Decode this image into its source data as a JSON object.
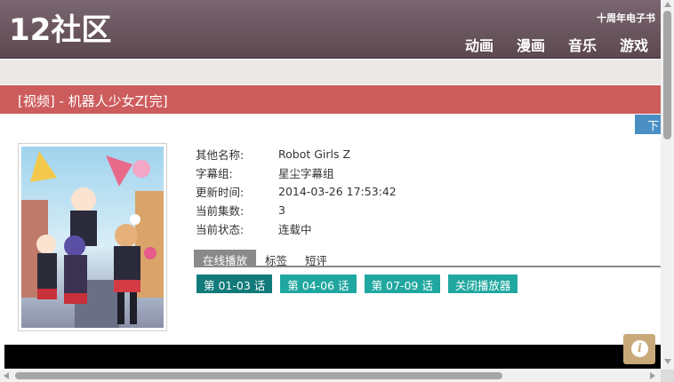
{
  "header": {
    "logo": "12社区",
    "ebook_link": "十周年电子书",
    "nav": [
      "动画",
      "漫画",
      "音乐",
      "游戏"
    ]
  },
  "title_bar": {
    "text": "[视频] - 机器人少女Z[完]"
  },
  "download_tab": {
    "label": "下"
  },
  "details": {
    "rows": [
      {
        "key": "其他名称:",
        "value": "Robot Girls Z"
      },
      {
        "key": "字幕组:",
        "value": "星尘字幕组"
      },
      {
        "key": "更新时间:",
        "value": "2014-03-26 17:53:42"
      },
      {
        "key": "当前集数:",
        "value": "3"
      },
      {
        "key": "当前状态:",
        "value": "连载中"
      }
    ]
  },
  "tabs": [
    "在线播放",
    "标签",
    "短评"
  ],
  "episodes": [
    "第 01-03 话",
    "第 04-06 话",
    "第 07-09 话",
    "关闭播放器"
  ],
  "info_button": {
    "glyph": "i"
  },
  "colors": {
    "header": "#6a5860",
    "title_bar": "#cd5c5c",
    "download_tab": "#4a8fc4",
    "episode_active": "#117a7a",
    "episode": "#1fa7a0",
    "tab_active": "#8a8a8a",
    "info_button": "#c9a97a"
  }
}
